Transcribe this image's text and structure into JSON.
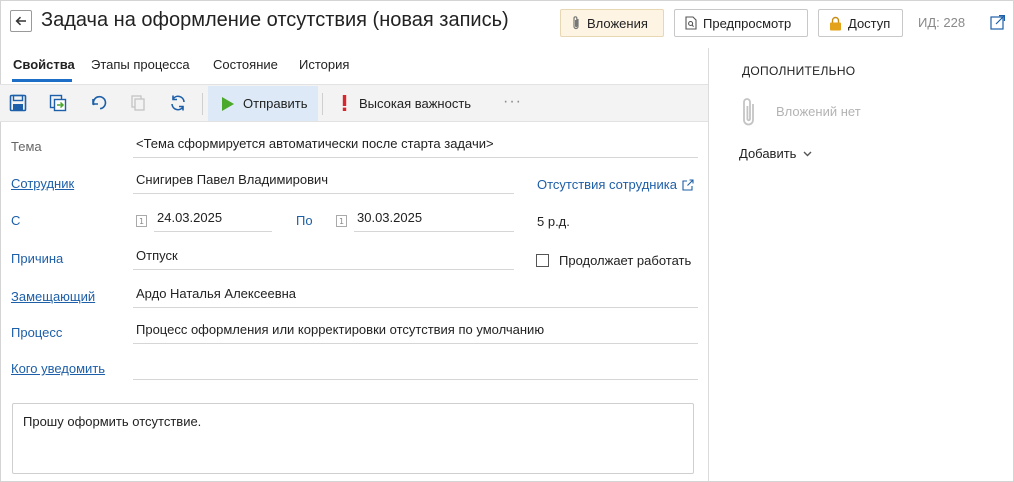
{
  "header": {
    "title": "Задача на оформление отсутствия (новая запись)",
    "attachments_label": "Вложения",
    "preview_label": "Предпросмотр",
    "access_label": "Доступ",
    "id_label": "ИД: 228"
  },
  "tabs": [
    {
      "label": "Свойства",
      "active": true
    },
    {
      "label": "Этапы процесса",
      "active": false
    },
    {
      "label": "Состояние",
      "active": false
    },
    {
      "label": "История",
      "active": false
    }
  ],
  "toolbar": {
    "send_label": "Отправить",
    "importance_label": "Высокая важность",
    "more_label": "···"
  },
  "form": {
    "subject_label": "Тема",
    "subject_value": "<Тема сформируется автоматически после старта задачи>",
    "employee_label": "Сотрудник",
    "employee_value": "Снигирев Павел Владимирович",
    "absences_link": "Отсутствия сотрудника",
    "from_label": "С",
    "from_value": "24.03.2025",
    "to_label": "По",
    "to_value": "30.03.2025",
    "date_icon_text": "1",
    "days_value": "5 р.д.",
    "reason_label": "Причина",
    "reason_value": "Отпуск",
    "keeps_working_label": "Продолжает работать",
    "substitute_label": "Замещающий",
    "substitute_value": "Ардо Наталья Алексеевна",
    "process_label": "Процесс",
    "process_value": "Процесс оформления или корректировки отсутствия по умолчанию",
    "notify_label": "Кого уведомить",
    "notify_value": "",
    "comment_value": "Прошу оформить отсутствие."
  },
  "side": {
    "title": "ДОПОЛНИТЕЛЬНО",
    "no_attachments": "Вложений нет",
    "add_label": "Добавить"
  },
  "colors": {
    "link_blue": "#1d5fa8",
    "tab_underline": "#1d6ec6",
    "send_highlight": "#dde9f6",
    "send_icon": "#4aa82a",
    "importance_icon": "#d9262c",
    "attach_button_bg": "#fdf4e3",
    "lock_icon": "#e3a21a"
  },
  "icons": {
    "back": "arrow-left-icon",
    "attach": "paperclip-icon",
    "preview": "document-preview-icon",
    "access": "lock-icon",
    "popout": "open-in-new-window-icon",
    "save": "floppy-disk-icon",
    "save_close": "save-and-close-icon",
    "undo": "undo-icon",
    "copy": "copy-icon",
    "refresh": "refresh-icon",
    "send": "play-triangle-icon",
    "importance": "exclamation-icon",
    "external": "external-link-icon",
    "dropdown": "chevron-down-icon"
  }
}
